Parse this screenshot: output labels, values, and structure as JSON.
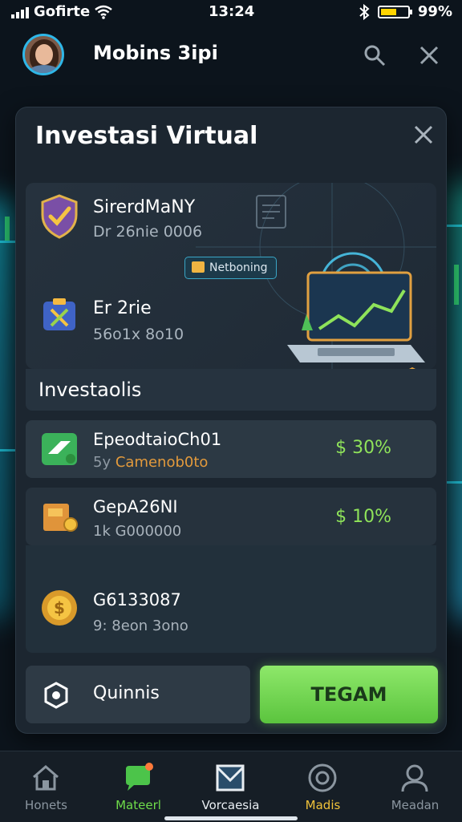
{
  "status_bar": {
    "carrier": "Gofirte",
    "time": "13:24",
    "battery": "99%",
    "battery_level": 0.6
  },
  "header": {
    "title": "Mobins 3ipi"
  },
  "modal": {
    "title": "Investasi Virtual",
    "hero": {
      "item1_name": "SirerdMaNY",
      "item1_sub": "Dr 26nie 0006",
      "tag": "Netboning",
      "item2_name": "Er 2rie",
      "item2_sub": "56o1x 8o10"
    },
    "section_title": "Investaolis",
    "items": [
      {
        "name": "EpeodtaioCh01",
        "sub_prefix": "5y",
        "sub": "Camenob0to",
        "rate": "$ 30%"
      },
      {
        "name": "GepA26NI",
        "sub_prefix": "",
        "sub": "1k G000000",
        "rate": "$ 10%"
      },
      {
        "name": "G6133087",
        "sub_prefix": "",
        "sub": "9: 8eon 3ono",
        "rate": ""
      }
    ],
    "secondary_button": "Quinnis",
    "primary_button": "TEGAM"
  },
  "nav": [
    {
      "label": "Honets",
      "color": "#8b96a0"
    },
    {
      "label": "Mateerl",
      "color": "#6fdc4a"
    },
    {
      "label": "Vorcaesia",
      "color": "#e9eef2"
    },
    {
      "label": "Madis",
      "color": "#f0c23a"
    },
    {
      "label": "Meadan",
      "color": "#8b96a0"
    }
  ],
  "icons": [
    "wifi-icon",
    "bluetooth-icon",
    "search-icon",
    "close-icon",
    "shield-check-icon",
    "tools-icon",
    "laptop-illustration",
    "card-icon",
    "box-icon",
    "coin-gear-icon",
    "hexagon-icon",
    "home-icon",
    "chat-icon",
    "envelope-icon",
    "target-icon",
    "user-icon"
  ]
}
